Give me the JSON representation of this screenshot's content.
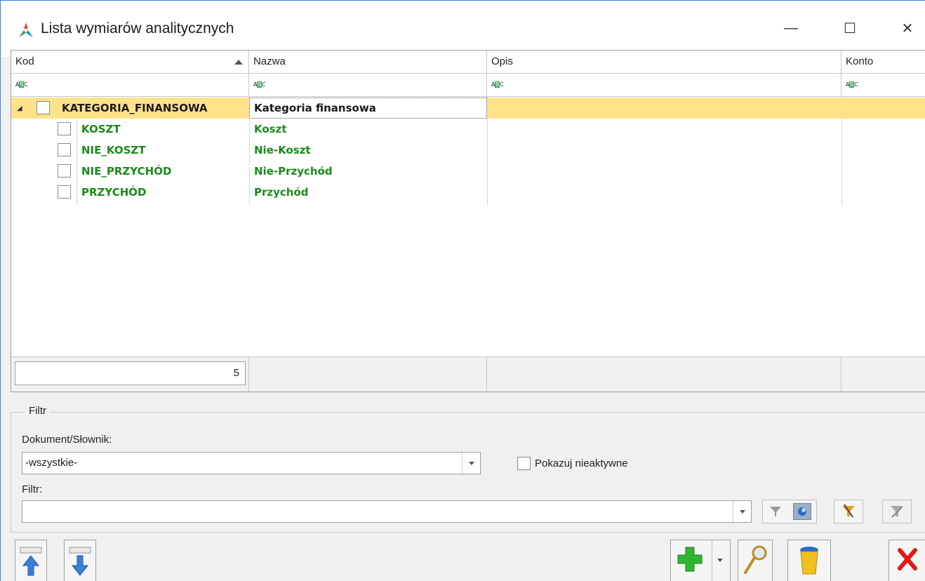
{
  "window": {
    "title": "Lista wymiarów analitycznych",
    "minimize_glyph": "—",
    "maximize_glyph": "☐",
    "close_glyph": "✕"
  },
  "grid": {
    "columns": [
      "Kod",
      "Nazwa",
      "Opis",
      "Konto"
    ],
    "filter_glyph": "ABC",
    "rows": [
      {
        "kod": "KATEGORIA_FINANSOWA",
        "nazwa": "Kategoria finansowa",
        "opis": "",
        "konto": "",
        "level": 0,
        "selected": true
      },
      {
        "kod": "KOSZT",
        "nazwa": "Koszt",
        "opis": "",
        "konto": "",
        "level": 1,
        "selected": false
      },
      {
        "kod": "NIE_KOSZT",
        "nazwa": "Nie-Koszt",
        "opis": "",
        "konto": "",
        "level": 1,
        "selected": false
      },
      {
        "kod": "NIE_PRZYCHÓD",
        "nazwa": "Nie-Przychód",
        "opis": "",
        "konto": "",
        "level": 1,
        "selected": false
      },
      {
        "kod": "PRZYCHÓD",
        "nazwa": "Przychód",
        "opis": "",
        "konto": "",
        "level": 1,
        "selected": false
      }
    ],
    "footer_count": "5"
  },
  "filter": {
    "legend": "Filtr",
    "dokument_label": "Dokument/Słownik:",
    "dokument_value": "-wszystkie-",
    "inactive_label": "Pokazuj nieaktywne",
    "filtr_label": "Filtr:",
    "filtr_value": ""
  },
  "colors": {
    "selection": "#fde28a",
    "green_text": "#1a8a1a",
    "window_border": "#3c7fd6"
  },
  "icons": {
    "app": "app-logo-icon",
    "up": "move-up-icon",
    "down": "move-down-icon",
    "add": "add-plus-icon",
    "search": "magnifier-icon",
    "delete": "trash-bin-icon",
    "close": "red-x-icon",
    "funnel": "funnel-icon"
  }
}
